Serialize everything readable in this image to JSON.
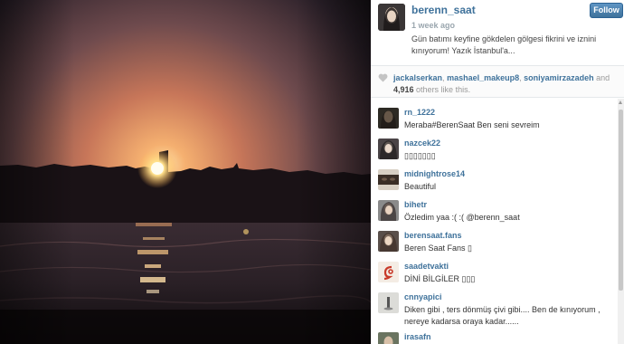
{
  "post": {
    "owner": "berenn_saat",
    "time": "1 week ago",
    "caption": "Gün batımı keyfine gökdelen gölgesi fikrini ve iznini kınıyorum! Yazık İstanbul'a...",
    "follow_label": "Follow"
  },
  "likes": {
    "users": [
      "jackalserkan",
      "mashael_makeup8",
      "soniyamirzazadeh"
    ],
    "separator": ", ",
    "and": "and",
    "others_count": "4,916",
    "others_suffix": "others like this."
  },
  "comments": [
    {
      "user": "rn_1222",
      "text": "Meraba#BerenSaat Ben seni sevreim"
    },
    {
      "user": "nazcek22",
      "text": "▯▯▯▯▯▯▯"
    },
    {
      "user": "midnightrose14",
      "text": "Beautiful"
    },
    {
      "user": "bihetr",
      "text": "Özledim yaa :( :( @berenn_saat"
    },
    {
      "user": "berensaat.fans",
      "text": "Beren Saat Fans ▯"
    },
    {
      "user": "saadetvakti",
      "text": "DİNİ BİLGİLER ▯▯▯"
    },
    {
      "user": "cnnyapici",
      "text": "Diken gibi , ters dönmüş çivi gibi.... Ben de kınıyorum , nereye kadarsa oraya kadar......"
    },
    {
      "user": "irasafn",
      "text": ""
    }
  ],
  "icons": {
    "heart": "heart-icon",
    "scroll_up": "chevron-up-icon"
  },
  "colors": {
    "link": "#3f729b",
    "follow_button": "#3f729b",
    "muted": "#999999"
  }
}
